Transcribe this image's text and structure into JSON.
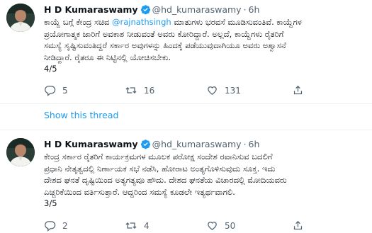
{
  "tweets": [
    {
      "name": "H D Kumaraswamy",
      "handle": "@hd_kumaraswamy",
      "separator": "·",
      "time": "6h",
      "lines": [
        [
          "ಕಾಯ್ದೆ ಬಗ್ಗೆ ಕೇಂದ್ರ ಸಚಿವ ",
          "@rajnathsingh",
          " ಮಾತುಗಳು ಭರವಸೆ ಮೂಡಿಸುವಂತಿವೆ. ಕಾಯ್ದೆಗಳ"
        ],
        [
          "ಪ್ರಯೋಗಾತ್ಮಕ ಜಾರಿಗೆ ಅವಕಾಶ ನೀಡುವಂತೆ ಅವರು ಕೋರಿದ್ದಾರೆ. ಅಲ್ಲದೆ, ಕಾಯ್ದೆಗಳು ರೈತರಿಗೆ"
        ],
        [
          "ಸಮಸ್ಯೆ ಸೃಷ್ಟಿಸುವಂತಿದ್ದರೆ ಸರ್ಕಾರ ಅವುಗಳನ್ನು ಹಿಂದಕ್ಕೆ ಪಡೆಯುವುದಾಗಿಯೂ ಅವರು ಅಶ್ವಾಸನೆ"
        ],
        [
          "ನೀಡಿದ್ದಾರೆ. ರೈತರೂ ಈ ನಿಟ್ಟಿನಲ್ಲಿ ಯೋಚಿಸಬೇಕು."
        ]
      ],
      "counter": "4/5",
      "replies": "5",
      "retweets": "16",
      "likes": "131"
    },
    {
      "name": "H D Kumaraswamy",
      "handle": "@hd_kumaraswamy",
      "separator": "·",
      "time": "6h",
      "lines": [
        [
          "ಕೇಂದ್ರ ಸರ್ಕಾರ ರೈತರಿಗೆ ಕಾರ್ಯಕ್ರಮಗಳ ಮೂಲಕ ಪರೋಕ್ಷ ಸಂದೇಶ ರವಾನಿಸುವ ಬದಲಿಗೆ"
        ],
        [
          "ಪ್ರಧಾನಿ ನೇತೃತ್ವದಲ್ಲಿ ನಿರ್ಣಾಯಕ ಸಭೆ ನಡೆಸಿ, ಹೋರಾಟ ಅಂತ್ಯಗೊಳಿಸುವುದು ಸೂಕ್ತ. ಇದು"
        ],
        [
          "ದೇಶದ ಘನತೆ ದೃಷ್ಟಿಯಿಂದ ಅತ್ಯಗತ್ಯವೂ ಹೌದು. ದೇಶದ ಘನತೆಯ ವಿಚಾರದಲ್ಲಿ ಮೋದಿಯವರು"
        ],
        [
          "ಎಚ್ಚರಿಕೆಯಿಂದ ವರ್ತಿಸುತ್ತಾರೆ. ಆದ್ದರಿಂದ ಸಮಸ್ಯೆ ಕೂಡಲೇ ಇತ್ಯರ್ಥವಾಗಲಿ."
        ]
      ],
      "counter": "3/5",
      "replies": "2",
      "retweets": "4",
      "likes": "50"
    }
  ],
  "show_thread": "Show this thread",
  "colors": {
    "accent": "#1d9bf0",
    "secondary_text": "#536471",
    "divider": "#eff3f4"
  },
  "icons": [
    "verified-badge-icon",
    "reply-icon",
    "retweet-icon",
    "like-icon",
    "share-icon"
  ]
}
